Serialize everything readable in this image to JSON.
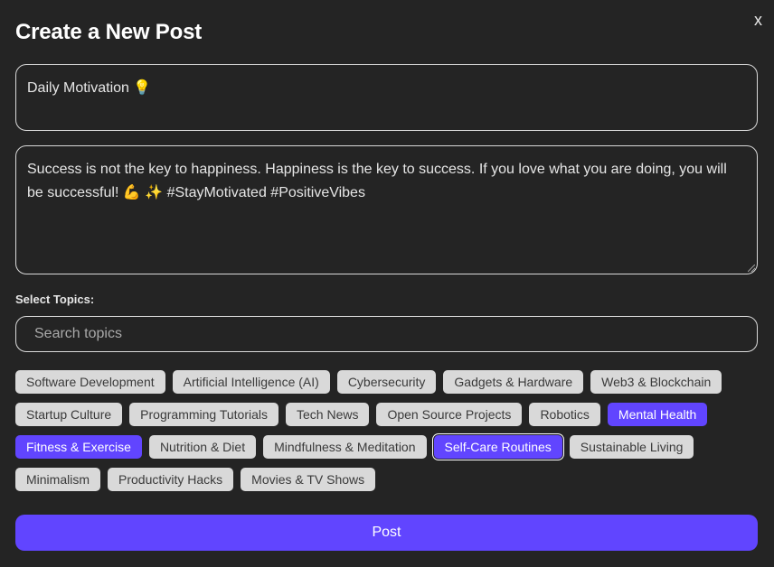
{
  "modal": {
    "title": "Create a New Post",
    "close_label": "x"
  },
  "post": {
    "title_value": "Daily Motivation 💡",
    "body_value": "Success is not the key to happiness. Happiness is the key to success. If you love what you are doing, you will be successful! 💪 ✨ #StayMotivated #PositiveVibes"
  },
  "topics": {
    "label": "Select Topics:",
    "search_placeholder": "Search topics",
    "items": [
      {
        "label": "Software Development",
        "selected": false
      },
      {
        "label": "Artificial Intelligence (AI)",
        "selected": false
      },
      {
        "label": "Cybersecurity",
        "selected": false
      },
      {
        "label": "Gadgets & Hardware",
        "selected": false
      },
      {
        "label": "Web3 & Blockchain",
        "selected": false
      },
      {
        "label": "Startup Culture",
        "selected": false
      },
      {
        "label": "Programming Tutorials",
        "selected": false
      },
      {
        "label": "Tech News",
        "selected": false
      },
      {
        "label": "Open Source Projects",
        "selected": false
      },
      {
        "label": "Robotics",
        "selected": false
      },
      {
        "label": "Mental Health",
        "selected": true
      },
      {
        "label": "Fitness & Exercise",
        "selected": true
      },
      {
        "label": "Nutrition & Diet",
        "selected": false
      },
      {
        "label": "Mindfulness & Meditation",
        "selected": false
      },
      {
        "label": "Self-Care Routines",
        "selected": true,
        "focused": true
      },
      {
        "label": "Sustainable Living",
        "selected": false
      },
      {
        "label": "Minimalism",
        "selected": false
      },
      {
        "label": "Productivity Hacks",
        "selected": false
      },
      {
        "label": "Movies & TV Shows",
        "selected": false
      }
    ]
  },
  "actions": {
    "post_label": "Post"
  },
  "colors": {
    "background": "#242424",
    "accent": "#6145ff",
    "chip": "#d9d9d9"
  }
}
